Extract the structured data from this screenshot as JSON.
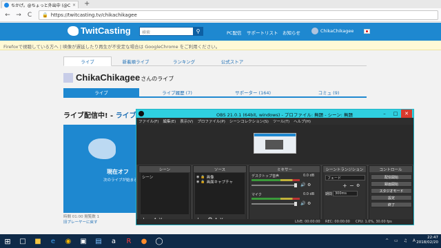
{
  "browser": {
    "tab_title": "ちかげ。@ちょっと外出中 (@C",
    "new_tab": "+",
    "url": "https://twitcasting.tv/chikachikagee",
    "back": "←",
    "forward": "→",
    "reload": "C"
  },
  "site": {
    "logo": "TwitCasting",
    "search_placeholder": "検索",
    "nav": [
      "PC配信",
      "サポートリスト",
      "お知らせ"
    ],
    "user_name": "ChikaChikagee",
    "notice": "Firefoxで視聴している方へ | 映像が遅延したり再生が不安定な場合は GoogleChrome をご利用ください。"
  },
  "top_tabs": [
    "ライブ",
    "新着順ライブ",
    "ランキング",
    "公式ストア"
  ],
  "channel": {
    "name": "ChikaChikagee",
    "suffix": "さんのライブ"
  },
  "sub_tabs": [
    "ライブ",
    "ライブ履歴 (7)",
    "サポーター (164)",
    "コミュ (9)"
  ],
  "live": {
    "heading": "ライブ配信中! - ",
    "heading_link": "ライブ",
    "player_text": "現在オフ",
    "player_sub": "次のライブが始まるまでお待ちください",
    "player_meta": "時間 01:00  閲覧数 1",
    "player_link": "旧プレーヤーに戻す"
  },
  "obs": {
    "title": "OBS 21.0.1 (64bit, windows) - プロファイル: 無題 - シーン: 無題",
    "menu": [
      "ファイル(F)",
      "編集(E)",
      "表示(V)",
      "プロファイル(P)",
      "シーンコレクション(S)",
      "ツール(T)",
      "ヘルプ(H)"
    ],
    "docks": {
      "scenes": "シーン",
      "sources": "ソース",
      "mixer": "ミキサー",
      "transitions": "シーントランジション",
      "controls": "コントロール"
    },
    "scene_items": [
      "シーン"
    ],
    "source_items": [
      "画像",
      "画面キャプチャ"
    ],
    "mixer_rows": [
      {
        "label": "デスクトップ音声",
        "db": "0.0 dB"
      },
      {
        "label": "マイク",
        "db": "0.0 dB"
      }
    ],
    "transition": "フェード",
    "duration_label": "期間",
    "duration": "300ms",
    "control_buttons": [
      "配信開始",
      "録画開始",
      "スタジオモード",
      "設定",
      "終了"
    ],
    "status": {
      "live": "LIVE: 00:00:00",
      "rec": "REC: 00:00:00",
      "cpu": "CPU: 1.0%, 30.00 fps"
    }
  },
  "taskbar": {
    "time": "22:47",
    "date": "2018/02/20"
  }
}
